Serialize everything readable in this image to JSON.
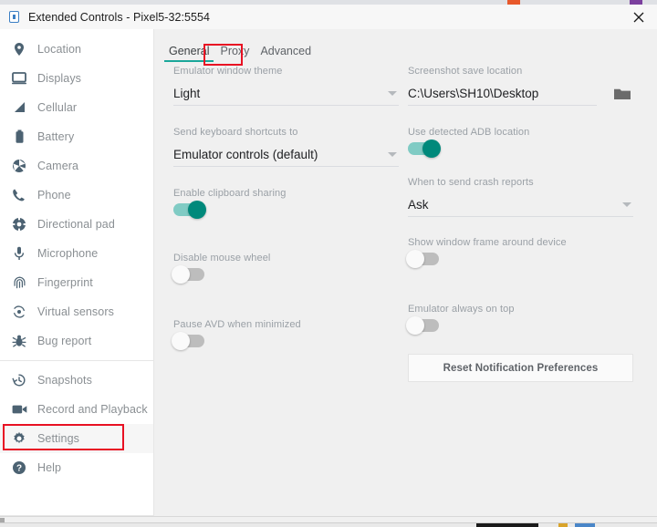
{
  "window": {
    "title": "Extended Controls - Pixel5-32:5554",
    "app_icon": "emulator-app-icon",
    "close_icon": "close-icon"
  },
  "sidebar": {
    "items": [
      {
        "label": "Location",
        "icon": "location-pin-icon"
      },
      {
        "label": "Displays",
        "icon": "monitor-icon"
      },
      {
        "label": "Cellular",
        "icon": "signal-bars-icon"
      },
      {
        "label": "Battery",
        "icon": "battery-icon"
      },
      {
        "label": "Camera",
        "icon": "camera-aperture-icon"
      },
      {
        "label": "Phone",
        "icon": "phone-handset-icon"
      },
      {
        "label": "Directional pad",
        "icon": "dpad-icon"
      },
      {
        "label": "Microphone",
        "icon": "microphone-icon"
      },
      {
        "label": "Fingerprint",
        "icon": "fingerprint-icon"
      },
      {
        "label": "Virtual sensors",
        "icon": "virtual-sensors-icon"
      },
      {
        "label": "Bug report",
        "icon": "bug-icon"
      },
      {
        "label": "Snapshots",
        "icon": "history-clock-icon"
      },
      {
        "label": "Record and Playback",
        "icon": "video-camera-icon"
      },
      {
        "label": "Settings",
        "icon": "gear-icon"
      },
      {
        "label": "Help",
        "icon": "question-mark-circle-icon"
      }
    ],
    "divider_after_index": 10,
    "selected": "Settings"
  },
  "tabs": [
    {
      "label": "General",
      "active": true
    },
    {
      "label": "Proxy",
      "active": false
    },
    {
      "label": "Advanced",
      "active": false
    }
  ],
  "settings": {
    "left": {
      "theme": {
        "label": "Emulator window theme",
        "value": "Light",
        "caret_icon": "chevron-down-icon"
      },
      "keyboard_shortcuts": {
        "label": "Send keyboard shortcuts to",
        "value": "Emulator controls (default)",
        "caret_icon": "chevron-down-icon"
      },
      "clipboard_sharing": {
        "label": "Enable clipboard sharing",
        "state": "on"
      },
      "disable_mouse_wheel": {
        "label": "Disable mouse wheel",
        "state": "off"
      },
      "pause_avd": {
        "label": "Pause AVD when minimized",
        "state": "off"
      }
    },
    "right": {
      "screenshot_location": {
        "label": "Screenshot save location",
        "value": "C:\\Users\\SH10\\Desktop",
        "browse_icon": "folder-icon"
      },
      "adb_location": {
        "label": "Use detected ADB location",
        "state": "on"
      },
      "crash_reports": {
        "label": "When to send crash reports",
        "value": "Ask",
        "caret_icon": "chevron-down-icon"
      },
      "window_frame": {
        "label": "Show window frame around device",
        "state": "off"
      },
      "always_on_top": {
        "label": "Emulator always on top",
        "state": "off"
      },
      "reset_button": {
        "label": "Reset Notification Preferences"
      }
    }
  },
  "highlights": {
    "accent_color": "#1aa79a",
    "toggle_on_color": "#00897b",
    "annotation_color": "#e81123",
    "annotated_elements": [
      "Proxy",
      "Settings"
    ]
  }
}
